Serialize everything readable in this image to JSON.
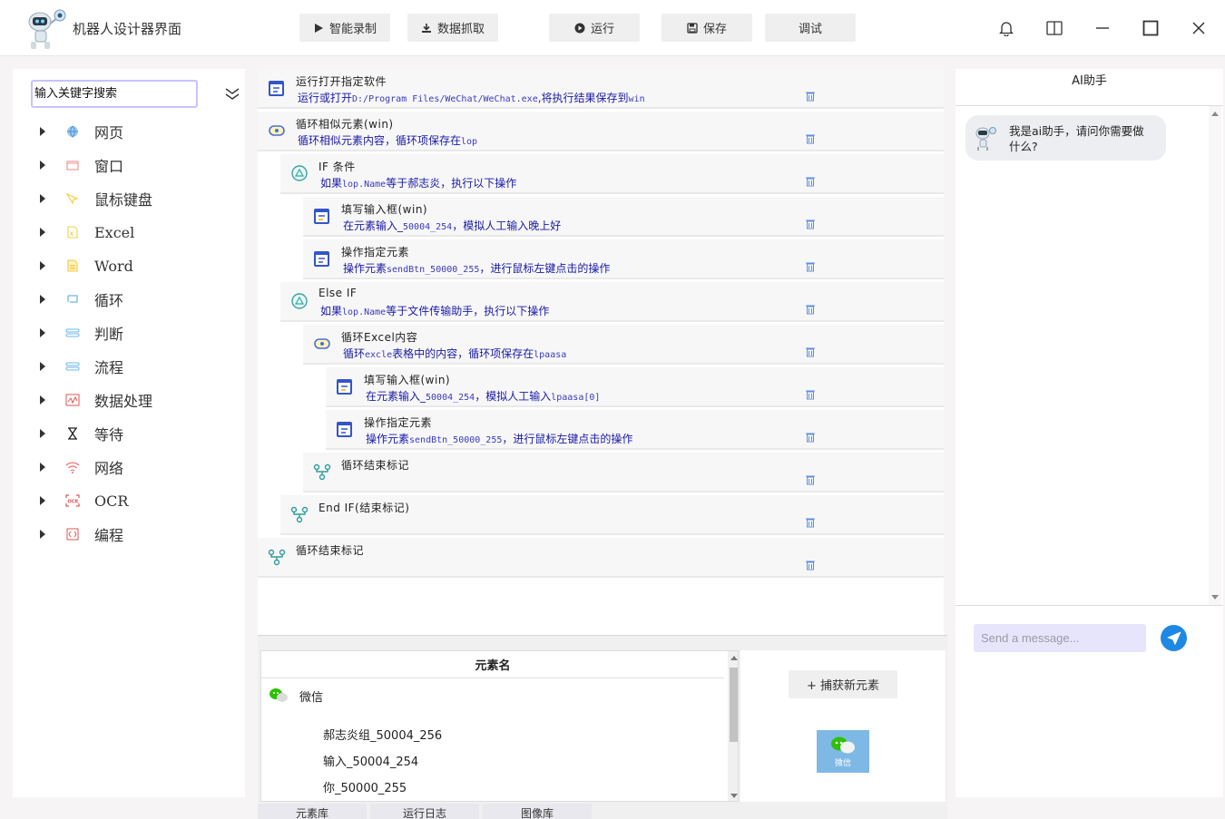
{
  "window": {
    "title": "机器人设计器界面"
  },
  "toolbar": {
    "record_label": "智能录制",
    "scrape_label": "数据抓取",
    "run_label": "运行",
    "save_label": "保存",
    "debug_label": "调试"
  },
  "left": {
    "search_placeholder": "输入关键字搜索",
    "items": [
      {
        "label": "网页",
        "icon": "globe-icon"
      },
      {
        "label": "窗口",
        "icon": "window-icon"
      },
      {
        "label": "鼠标键盘",
        "icon": "mouse-icon"
      },
      {
        "label": "Excel",
        "icon": "excel-file-icon"
      },
      {
        "label": "Word",
        "icon": "word-file-icon"
      },
      {
        "label": "循环",
        "icon": "loop-icon"
      },
      {
        "label": "判断",
        "icon": "branch-icon"
      },
      {
        "label": "流程",
        "icon": "flow-icon"
      },
      {
        "label": "数据处理",
        "icon": "chart-icon"
      },
      {
        "label": "等待",
        "icon": "hourglass-icon"
      },
      {
        "label": "网络",
        "icon": "wifi-icon"
      },
      {
        "label": "OCR",
        "icon": "ocr-icon"
      },
      {
        "label": "编程",
        "icon": "code-icon"
      }
    ]
  },
  "flow": {
    "steps": [
      {
        "title": "运行打开指定软件",
        "desc_pre": "运行或打开",
        "desc_code": "D:/Program Files/WeChat/WeChat.exe",
        "desc_post": ",将执行结果保存到",
        "desc_code2": "win",
        "icon": "app-window-icon"
      },
      {
        "title": "循环相似元素(win)",
        "desc_pre": "循环相似元素内容，循环项保存在",
        "desc_code": "lop",
        "desc_post": "",
        "desc_code2": "",
        "icon": "loop-element-icon"
      },
      {
        "title": "IF 条件",
        "desc_pre": "如果",
        "desc_code": "lop.Name",
        "desc_post": "等于郝志炎，执行以下操作",
        "desc_code2": "",
        "icon": "condition-icon"
      },
      {
        "title": "填写输入框(win)",
        "desc_pre": "在元素输入_",
        "desc_code": "50004_254",
        "desc_post": "，模拟人工输入晚上好",
        "desc_code2": "",
        "icon": "input-box-icon"
      },
      {
        "title": "操作指定元素",
        "desc_pre": "操作元素",
        "desc_code": "sendBtn_50000_255",
        "desc_post": "，进行鼠标左键点击的操作",
        "desc_code2": "",
        "icon": "element-action-icon"
      },
      {
        "title": "Else IF",
        "desc_pre": "如果",
        "desc_code": "lop.Name",
        "desc_post": "等于文件传输助手，执行以下操作",
        "desc_code2": "",
        "icon": "condition-icon"
      },
      {
        "title": "循环Excel内容",
        "desc_pre": "循环",
        "desc_code": "excle",
        "desc_post": "表格中的内容，循环项保存在",
        "desc_code2": "lpaasa",
        "icon": "loop-excel-icon"
      },
      {
        "title": "填写输入框(win)",
        "desc_pre": "在元素输入_",
        "desc_code": "50004_254",
        "desc_post": "，模拟人工输入",
        "desc_code2": "lpaasa[0]",
        "icon": "input-box-icon"
      },
      {
        "title": "操作指定元素",
        "desc_pre": "操作元素",
        "desc_code": "sendBtn_50000_255",
        "desc_post": "，进行鼠标左键点击的操作",
        "desc_code2": "",
        "icon": "element-action-icon"
      },
      {
        "title": "循环结束标记",
        "desc_pre": "",
        "desc_code": "",
        "desc_post": "",
        "desc_code2": "",
        "icon": "end-marker-icon"
      },
      {
        "title": "End IF(结束标记)",
        "desc_pre": "",
        "desc_code": "",
        "desc_post": "",
        "desc_code2": "",
        "icon": "end-marker-icon"
      },
      {
        "title": "循环结束标记",
        "desc_pre": "",
        "desc_code": "",
        "desc_post": "",
        "desc_code2": "",
        "icon": "end-marker-icon"
      }
    ]
  },
  "elements": {
    "header": "元素名",
    "root": "微信",
    "children": [
      "郝志炎组_50004_256",
      "输入_50004_254",
      "你_50000_255"
    ],
    "capture_label": "+ 捕获新元素",
    "thumb_label": "微信"
  },
  "tabs": [
    "元素库",
    "运行日志",
    "图像库"
  ],
  "ai": {
    "title": "AI助手",
    "greeting": "我是ai助手，请问你需要做什么?",
    "input_placeholder": "Send a message..."
  },
  "colors": {
    "accent": "#1e88e5",
    "desc_text": "#1a1aa8",
    "search_border": "#c7c3ff",
    "message_input_bg": "#e7e5fb"
  }
}
